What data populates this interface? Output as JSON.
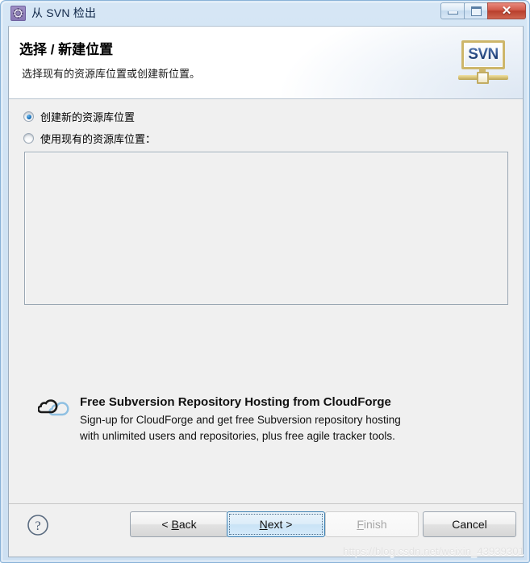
{
  "window": {
    "title": "从 SVN 检出",
    "icon": "svn-checkout-icon",
    "controls": {
      "minimize_label": "—",
      "maximize_label": "□",
      "close_label": "✕"
    }
  },
  "header": {
    "title": "选择 / 新建位置",
    "subtitle": "选择现有的资源库位置或创建新位置。",
    "logo_text": "SVN"
  },
  "options": {
    "create_new": {
      "label": "创建新的资源库位置",
      "selected": true
    },
    "use_existing": {
      "label": "使用现有的资源库位置：",
      "selected": false
    }
  },
  "repository_list": {
    "items": [],
    "empty": true
  },
  "promo": {
    "title": "Free Subversion Repository Hosting from CloudForge",
    "line1": "Sign-up for CloudForge and get free Subversion repository hosting",
    "line2": "with unlimited users and repositories, plus free agile tracker tools.",
    "icon": "cloud-icon"
  },
  "buttons": {
    "help": "?",
    "back": "< Back",
    "next": "Next >",
    "finish": "Finish",
    "cancel": "Cancel"
  },
  "watermark": "https://blog.csdn.net/weixin_43939301",
  "colors": {
    "frame": "#cfe2f3",
    "client_bg": "#f0f0f0",
    "header_bg": "#ffffff",
    "accent": "#3c7fb1",
    "close_red": "#c0392b",
    "svn_blue": "#24457e",
    "svn_gold": "#cdb66a"
  }
}
